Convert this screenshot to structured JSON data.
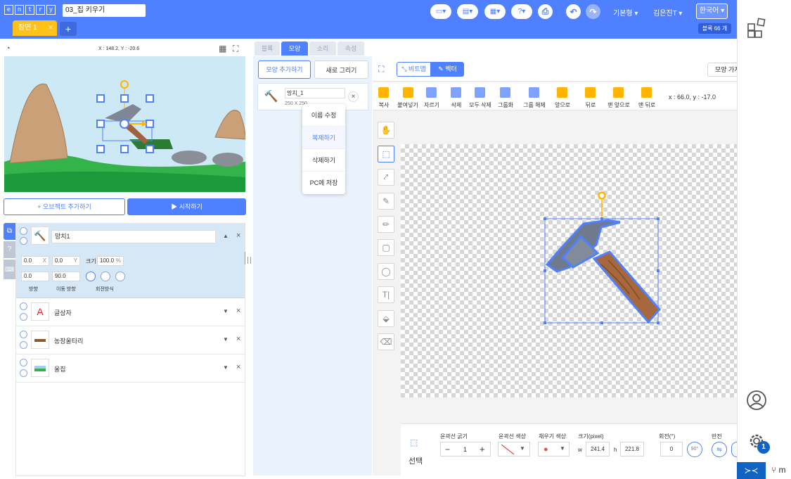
{
  "app": {
    "logo": "entry",
    "project_name": "03_집 키우기",
    "block_count": "블록 66 개"
  },
  "topbar": {
    "mode_label": "기본형",
    "user_label": "김은진T",
    "lang_label": "한국어"
  },
  "scene": {
    "tab_label": "장면 1",
    "close": "×",
    "add": "+"
  },
  "stage": {
    "coords": "X : 148.2, Y : -20.6"
  },
  "stage_buttons": {
    "add_object": "+ 오브젝트 추가하기",
    "start": "▶ 시작하기"
  },
  "objects": [
    {
      "name": "망치1",
      "x": "0.0",
      "y": "0.0",
      "size": "100.0",
      "direction": "0.0",
      "move_direction": "90.0"
    },
    {
      "name": "글상자"
    },
    {
      "name": "농장울타리"
    },
    {
      "name": "울집"
    }
  ],
  "object_labels": {
    "x": "X",
    "y": "Y",
    "size": "크기",
    "pct": "%",
    "direction": "방향",
    "move_direction": "이동 방향",
    "rotation": "회전방식"
  },
  "editor_tabs": [
    "블록",
    "모양",
    "소리",
    "속성"
  ],
  "shape_panel": {
    "add_shape": "모양 추가하기",
    "new_draw": "새로 그리기",
    "shape_name": "망치_1",
    "shape_size": "250 X 250"
  },
  "context_menu": [
    "이름 수정",
    "복제하기",
    "삭제하기",
    "PC에 저장"
  ],
  "paint": {
    "bitmap": "비트맵",
    "vector": "벡터",
    "import": "모양 가져",
    "coords": "x : 66.0, y : -17.0"
  },
  "ribbon": [
    "복사",
    "붙여넣기",
    "자르기",
    "삭제",
    "모두 삭제",
    "그룹화",
    "그룹 해제",
    "앞으로",
    "뒤로",
    "맨 앞으로",
    "맨 뒤로"
  ],
  "props": {
    "select": "선택",
    "stroke_width": "윤곽선 굵기",
    "stroke_width_val": "1",
    "stroke_color": "윤곽선 색상",
    "fill_color": "채우기 색상",
    "size": "크기(pixel)",
    "w": "w",
    "w_val": "241.4",
    "h": "h",
    "h_val": "221.8",
    "rotation": "회전(°)",
    "rotation_val": "0",
    "rot90": "90°",
    "flip": "반전",
    "minus": "−",
    "plus": "+"
  },
  "rail": {
    "badge": "1"
  },
  "colors": {
    "primary": "#4f80ff",
    "accent": "#ffc21a"
  }
}
